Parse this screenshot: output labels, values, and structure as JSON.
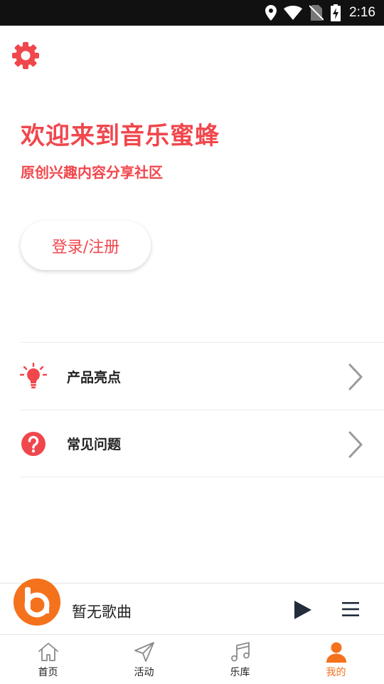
{
  "status_bar": {
    "time": "2:16"
  },
  "header": {
    "settings_icon": "gear-icon"
  },
  "hero": {
    "title": "欢迎来到音乐蜜蜂",
    "subtitle": "原创兴趣内容分享社区",
    "login_label": "登录/注册"
  },
  "menu": {
    "items": [
      {
        "label": "产品亮点",
        "icon": "lightbulb-icon"
      },
      {
        "label": "常见问题",
        "icon": "question-icon"
      }
    ]
  },
  "player": {
    "title": "暂无歌曲"
  },
  "nav": {
    "items": [
      {
        "label": "首页",
        "icon": "home-icon"
      },
      {
        "label": "活动",
        "icon": "send-icon"
      },
      {
        "label": "乐库",
        "icon": "music-note-icon"
      },
      {
        "label": "我的",
        "icon": "profile-icon"
      }
    ]
  },
  "colors": {
    "accent_red": "#f0474d",
    "accent_orange": "#f4721c"
  }
}
